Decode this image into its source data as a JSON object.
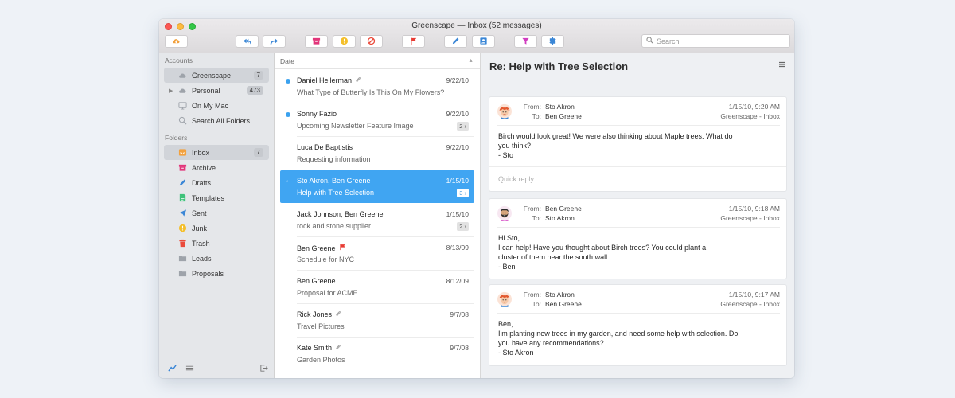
{
  "window": {
    "title": "Greenscape — Inbox (52 messages)"
  },
  "toolbar": {
    "buttons": [
      {
        "name": "get-mail-icon",
        "color": "#f2a13e"
      },
      {
        "name": "reply-all-icon",
        "color": "#3a86d6"
      },
      {
        "name": "forward-icon",
        "color": "#3a86d6"
      },
      {
        "name": "archive-icon",
        "color": "#e2357a"
      },
      {
        "name": "junk-icon",
        "color": "#f4bf2a"
      },
      {
        "name": "block-icon",
        "color": "#ea4a3b"
      },
      {
        "name": "flag-icon",
        "color": "#e83b33"
      },
      {
        "name": "compose-icon",
        "color": "#3a86d6"
      },
      {
        "name": "contacts-icon",
        "color": "#3a86d6"
      },
      {
        "name": "filter-icon",
        "color": "#d13cc0"
      },
      {
        "name": "rules-icon",
        "color": "#3a86d6"
      }
    ],
    "search_placeholder": "Search"
  },
  "sidebar": {
    "accounts_heading": "Accounts",
    "accounts": [
      {
        "label": "Greenscape",
        "badge": "7",
        "icon": "cloud-icon",
        "selected": true,
        "expand": false
      },
      {
        "label": "Personal",
        "badge": "473",
        "icon": "cloud-icon",
        "selected": false,
        "expand": true
      },
      {
        "label": "On My Mac",
        "badge": "",
        "icon": "monitor-icon",
        "selected": false,
        "expand": false
      },
      {
        "label": "Search All Folders",
        "badge": "",
        "icon": "search-icon",
        "selected": false,
        "expand": false
      }
    ],
    "folders_heading": "Folders",
    "folders": [
      {
        "label": "Inbox",
        "badge": "7",
        "icon": "inbox-icon",
        "color": "#f2a13e",
        "selected": true
      },
      {
        "label": "Archive",
        "badge": "",
        "icon": "archive-icon",
        "color": "#e2357a",
        "selected": false
      },
      {
        "label": "Drafts",
        "badge": "",
        "icon": "pencil-icon",
        "color": "#3a86d6",
        "selected": false
      },
      {
        "label": "Templates",
        "badge": "",
        "icon": "template-icon",
        "color": "#3ec27a",
        "selected": false
      },
      {
        "label": "Sent",
        "badge": "",
        "icon": "send-icon",
        "color": "#3a86d6",
        "selected": false
      },
      {
        "label": "Junk",
        "badge": "",
        "icon": "junk-icon",
        "color": "#f4bf2a",
        "selected": false
      },
      {
        "label": "Trash",
        "badge": "",
        "icon": "trash-icon",
        "color": "#ea4a3b",
        "selected": false
      },
      {
        "label": "Leads",
        "badge": "",
        "icon": "folder-icon",
        "color": "#9ea3aa",
        "selected": false
      },
      {
        "label": "Proposals",
        "badge": "",
        "icon": "folder-icon",
        "color": "#9ea3aa",
        "selected": false
      }
    ]
  },
  "list": {
    "sort_label": "Date",
    "messages": [
      {
        "sender": "Daniel Hellerman",
        "subject": "What Type of Butterfly Is This On My Flowers?",
        "date": "9/22/10",
        "unread": true,
        "attachment": true,
        "flag": false,
        "count": "",
        "replied": false,
        "selected": false
      },
      {
        "sender": "Sonny Fazio",
        "subject": "Upcoming Newsletter Feature Image",
        "date": "9/22/10",
        "unread": true,
        "attachment": false,
        "flag": false,
        "count": "2 ›",
        "replied": false,
        "selected": false
      },
      {
        "sender": "Luca De Baptistis",
        "subject": "Requesting information",
        "date": "9/22/10",
        "unread": false,
        "attachment": false,
        "flag": false,
        "count": "",
        "replied": false,
        "selected": false
      },
      {
        "sender": "Sto Akron, Ben Greene",
        "subject": "Help with Tree Selection",
        "date": "1/15/10",
        "unread": false,
        "attachment": false,
        "flag": false,
        "count": "3 ›",
        "replied": true,
        "selected": true
      },
      {
        "sender": "Jack Johnson, Ben Greene",
        "subject": "rock and stone supplier",
        "date": "1/15/10",
        "unread": false,
        "attachment": false,
        "flag": false,
        "count": "2 ›",
        "replied": false,
        "selected": false
      },
      {
        "sender": "Ben Greene",
        "subject": "Schedule for NYC",
        "date": "8/13/09",
        "unread": false,
        "attachment": false,
        "flag": true,
        "count": "",
        "replied": false,
        "selected": false
      },
      {
        "sender": "Ben Greene",
        "subject": "Proposal for ACME",
        "date": "8/12/09",
        "unread": false,
        "attachment": false,
        "flag": false,
        "count": "",
        "replied": false,
        "selected": false
      },
      {
        "sender": "Rick Jones",
        "subject": "Travel Pictures",
        "date": "9/7/08",
        "unread": false,
        "attachment": true,
        "flag": false,
        "count": "",
        "replied": false,
        "selected": false
      },
      {
        "sender": "Kate Smith",
        "subject": "Garden Photos",
        "date": "9/7/08",
        "unread": false,
        "attachment": true,
        "flag": false,
        "count": "",
        "replied": false,
        "selected": false
      }
    ]
  },
  "reading": {
    "title": "Re: Help with Tree Selection",
    "from_label": "From:",
    "to_label": "To:",
    "quick_reply_placeholder": "Quick reply...",
    "messages": [
      {
        "from": "Sto Akron",
        "to": "Ben Greene",
        "datetime": "1/15/10, 9:20 AM",
        "mailbox": "Greenscape - Inbox",
        "avatar": "avatar-redhair",
        "body": "Birch would look great!  We were also thinking about Maple trees.  What do\nyou think?\n- Sto"
      },
      {
        "from": "Ben Greene",
        "to": "Sto Akron",
        "datetime": "1/15/10, 9:18 AM",
        "mailbox": "Greenscape - Inbox",
        "avatar": "avatar-beard",
        "body": "Hi Sto,\nI can help!  Have you thought about Birch trees?  You could plant a\ncluster of them near the south wall.\n- Ben"
      },
      {
        "from": "Sto Akron",
        "to": "Ben Greene",
        "datetime": "1/15/10, 9:17 AM",
        "mailbox": "Greenscape - Inbox",
        "avatar": "avatar-redhair",
        "body": "Ben,\nI'm planting new trees in my garden, and need some help with selection.  Do\nyou have any recommendations?\n- Sto Akron"
      }
    ]
  }
}
